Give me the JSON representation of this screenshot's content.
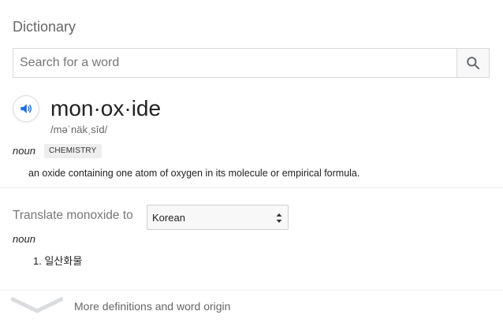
{
  "dictionary": {
    "title": "Dictionary",
    "search": {
      "placeholder": "Search for a word",
      "value": ""
    },
    "entry": {
      "word": "mon·ox·ide",
      "phonetic": "/məˈnäkˌsīd/",
      "part_of_speech": "noun",
      "subject_tag": "CHEMISTRY",
      "definition": "an oxide containing one atom of oxygen in its molecule or empirical formula."
    },
    "translate": {
      "label": "Translate monoxide to",
      "selected_language": "Korean",
      "part_of_speech": "noun",
      "items": [
        "1. 일산화물"
      ]
    },
    "footer": {
      "more_label": "More definitions and word origin"
    }
  },
  "colors": {
    "accent": "#1a73e8",
    "muted_text": "#666666",
    "divider": "#ebebeb",
    "tag_bg": "#eeeeee"
  },
  "icons": [
    "search-icon",
    "speaker-icon",
    "select-arrows-icon",
    "chevron-down-icon"
  ]
}
